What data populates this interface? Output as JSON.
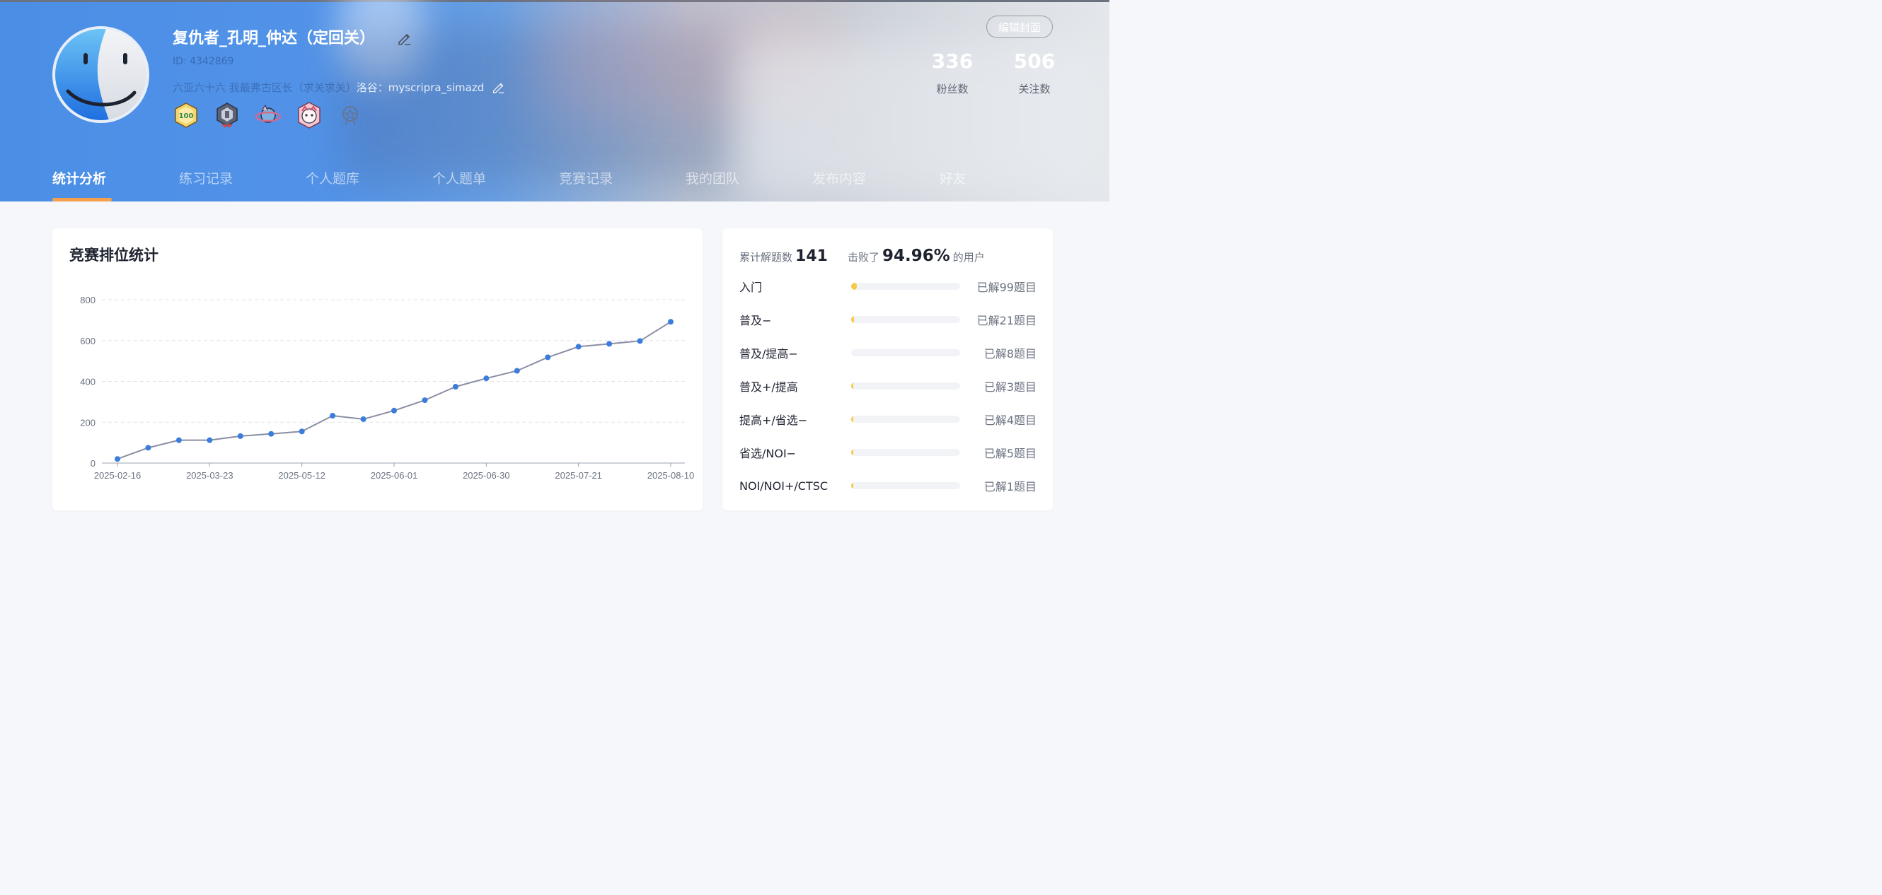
{
  "profile": {
    "username": "复仇者_孔明_仲达（定回关）",
    "uid": "ID: 4342869",
    "bio_prefix": "六亚六十六 我最弗古区长（求关求关）",
    "bio_suffix": "洛谷：myscripra_simazd",
    "cover_button": "编辑封面",
    "fans_count": "336",
    "fans_label": "粉丝数",
    "following_count": "506",
    "following_label": "关注数",
    "badges": [
      {
        "name": "badge-100-icon",
        "text": "100"
      },
      {
        "name": "badge-shield-icon"
      },
      {
        "name": "badge-planet-icon"
      },
      {
        "name": "badge-character-icon"
      },
      {
        "name": "badge-medal-outline-icon"
      }
    ]
  },
  "tabs": [
    {
      "label": "统计分析",
      "active": true
    },
    {
      "label": "练习记录"
    },
    {
      "label": "个人题库"
    },
    {
      "label": "个人题单"
    },
    {
      "label": "竞赛记录"
    },
    {
      "label": "我的团队"
    },
    {
      "label": "发布内容"
    },
    {
      "label": "好友"
    }
  ],
  "chart_card": {
    "title": "竞赛排位统计"
  },
  "chart_data": {
    "type": "line",
    "title": "竞赛排位统计",
    "xlabel": "",
    "ylabel": "",
    "ylim": [
      0,
      800
    ],
    "yticks": [
      0,
      200,
      400,
      600,
      800
    ],
    "xtick_labels": [
      "2025-02-16",
      "2025-03-23",
      "2025-05-12",
      "2025-06-01",
      "2025-06-30",
      "2025-07-21",
      "2025-08-10"
    ],
    "xtick_positions": [
      0,
      3,
      6,
      9,
      12,
      15,
      18
    ],
    "grid": true,
    "line_color": "#8a8ea3",
    "point_color": "#3b7ddd",
    "values": [
      20,
      75,
      112,
      112,
      132,
      143,
      155,
      232,
      215,
      257,
      308,
      374,
      415,
      452,
      518,
      570,
      584,
      598,
      692
    ]
  },
  "stats": {
    "total_label": "累计解题数",
    "total_value": "141",
    "beat_prefix": "击败了",
    "beat_value": "94.96%",
    "beat_suffix": "的用户",
    "levels": [
      {
        "name": "入门",
        "solved": "已解99题目",
        "fill": 0.05
      },
      {
        "name": "普及−",
        "solved": "已解21题目",
        "fill": 0.025
      },
      {
        "name": "普及/提高−",
        "solved": "已解8题目",
        "fill": 0.0
      },
      {
        "name": "普及+/提高",
        "solved": "已解3题目",
        "fill": 0.01
      },
      {
        "name": "提高+/省选−",
        "solved": "已解4题目",
        "fill": 0.01
      },
      {
        "name": "省选/NOI−",
        "solved": "已解5题目",
        "fill": 0.015
      },
      {
        "name": "NOI/NOI+/CTSC",
        "solved": "已解1题目",
        "fill": 0.015
      }
    ],
    "fill_color": "#f7c948"
  }
}
